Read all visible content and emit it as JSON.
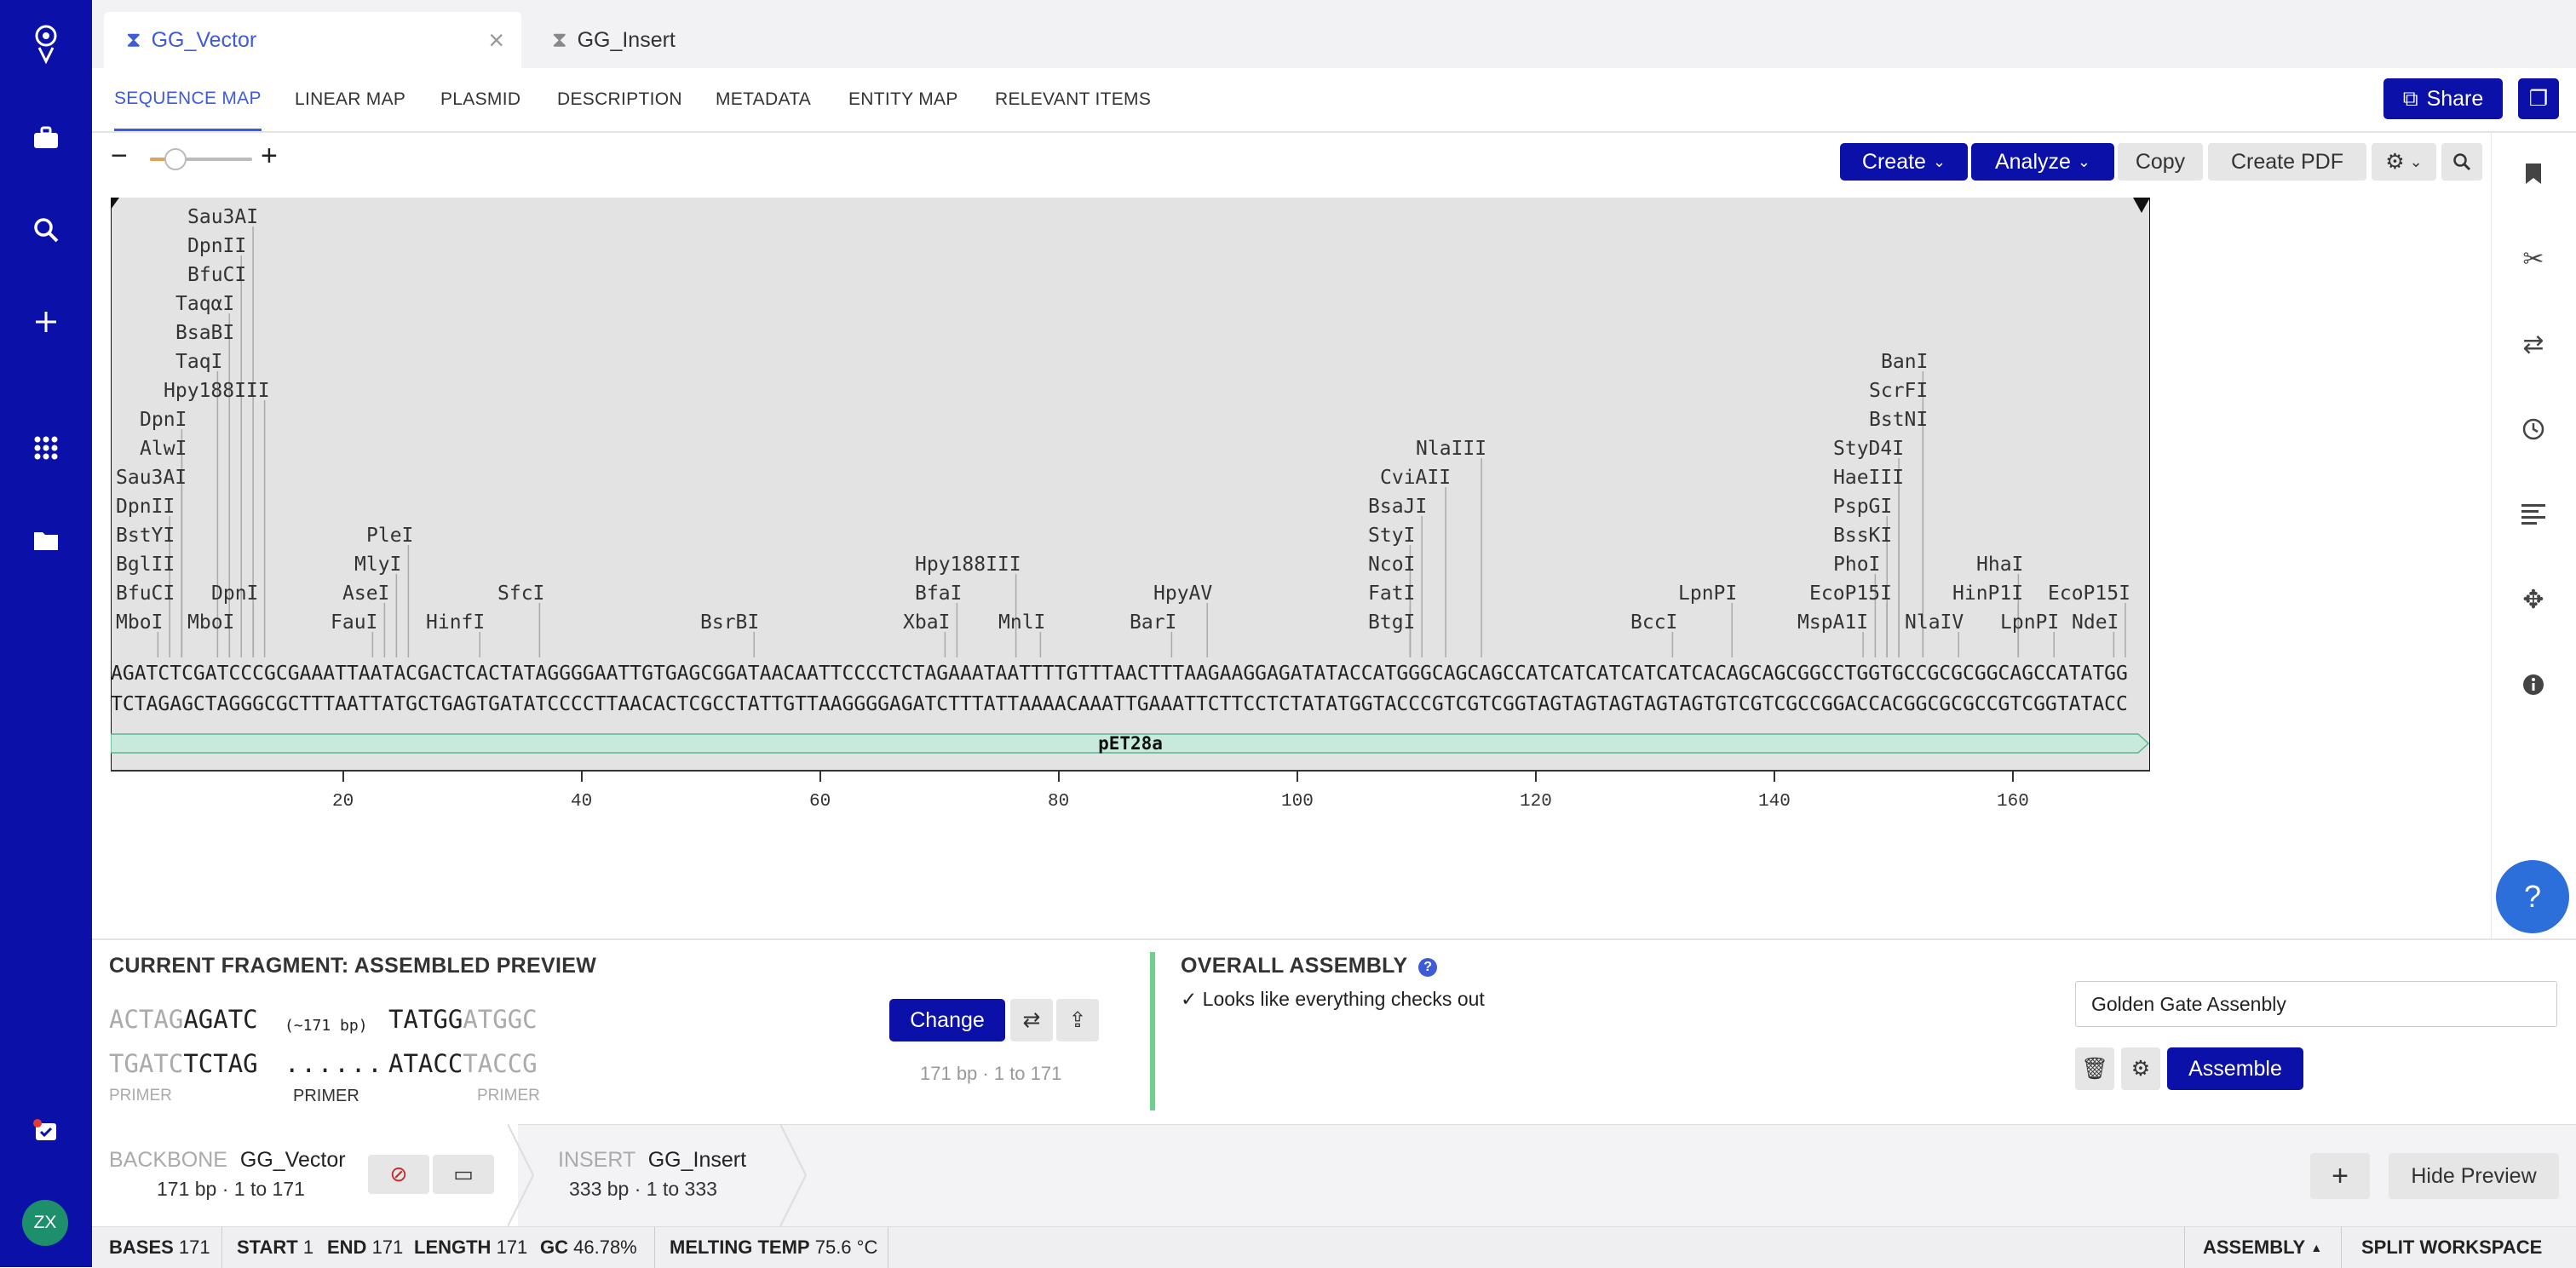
{
  "tabs": [
    {
      "label": "GG_Vector",
      "active": true
    },
    {
      "label": "GG_Insert",
      "active": false
    }
  ],
  "subnav": [
    "SEQUENCE MAP",
    "LINEAR MAP",
    "PLASMID",
    "DESCRIPTION",
    "METADATA",
    "ENTITY MAP",
    "RELEVANT ITEMS"
  ],
  "share_label": "Share",
  "toolbar": {
    "create": "Create",
    "analyze": "Analyze",
    "copy": "Copy",
    "create_pdf": "Create PDF",
    "zoom_level": 0.25
  },
  "map": {
    "enzymes": [
      "Sau3AI",
      "DpnII",
      "BfuCI",
      "TaqαI",
      "BsaBI",
      "TaqI",
      "Hpy188III",
      "DpnI",
      "AlwI",
      "Sau3AI",
      "DpnII",
      "BstYI",
      "BglII",
      "BfuCI",
      "MboI",
      "MboI",
      "DpnI",
      "PleI",
      "MlyI",
      "AseI",
      "FauI",
      "HinfI",
      "SfcI",
      "BsrBI",
      "Hpy188III",
      "BfaI",
      "XbaI",
      "MnlI",
      "HpyAV",
      "BarI",
      "NlaIII",
      "CviAII",
      "BsaJI",
      "StyI",
      "NcoI",
      "FatI",
      "BtgI",
      "LpnPI",
      "BccI",
      "BanI",
      "ScrFI",
      "BstNI",
      "StyD4I",
      "HaeIII",
      "PspGI",
      "BssKI",
      "PhoI",
      "EcoP15I",
      "MspA1I",
      "HhaI",
      "HinP1I",
      "NlaIV",
      "LpnPI",
      "EcoP15I",
      "NdeI"
    ],
    "seq_top": "AGATCTCGATCCCGCGAAATTAATACGACTCACTATAGGGGAATTGTGAGCGGATAACAATTCCCCTCTAGAAATAATTTTGTTTAACTTTAAGAAGGAGATATACCATGGGCAGCAGCCATCATCATCATCATCACAGCAGCGGCCTGGTGCCGCGCGGCAGCCATATGG",
    "seq_bottom": "TCTAGAGCTAGGGCGCTTTAATTATGCTGAGTGATATCCCCTTAACACTCGCCTATTGTTAAGGGGAGATCTTTATTAAAACAAATTGAAATTCTTCCTCTATATGGTACCCGTCGTCGGTAGTAGTAGTAGTAGTGTCGTCGCCGGACCACGGCGCGCCGTCGGTATACC",
    "feature": "pET28a",
    "ticks": [
      "20",
      "40",
      "60",
      "80",
      "100",
      "120",
      "140",
      "160"
    ]
  },
  "fragment": {
    "title": "CURRENT FRAGMENT: ASSEMBLED PREVIEW",
    "left_top_grey": "ACTAG",
    "left_top": "AGATC",
    "left_bot_grey": "TGATC",
    "left_bot": "TCTAG",
    "mid_top": "(~171 bp)",
    "mid_bot": "......",
    "right_top": "TATGG",
    "right_top_grey": "ATGGC",
    "right_bot": "ATACC",
    "right_bot_grey": "TACCG",
    "primer_left": "PRIMER",
    "primer_mid": "PRIMER",
    "primer_right": "PRIMER",
    "change": "Change",
    "range": "171 bp · 1 to 171"
  },
  "assembly": {
    "title": "OVERALL ASSEMBLY",
    "status": "Looks like everything checks out",
    "name_value": "Golden Gate Assenbly",
    "assemble": "Assemble"
  },
  "parts": {
    "backbone_label": "BACKBONE",
    "backbone_name": "GG_Vector",
    "backbone_info": "171 bp  ·  1 to 171",
    "insert_label": "INSERT",
    "insert_name": "GG_Insert",
    "insert_info": "333 bp  ·  1 to 333",
    "hide_preview": "Hide Preview"
  },
  "status": {
    "bases_label": "BASES",
    "bases": "171",
    "start_label": "START",
    "start": "1",
    "end_label": "END",
    "end": "171",
    "length_label": "LENGTH",
    "length": "171",
    "gc_label": "GC",
    "gc": "46.78%",
    "melt_label": "MELTING TEMP",
    "melt": "75.6 °C",
    "assembly": "ASSEMBLY",
    "split": "SPLIT WORKSPACE"
  },
  "user_initials": "ZX",
  "colors": {
    "nav": "#0b10a8",
    "accent": "#3e5bd9",
    "feature": "#c8eadc",
    "ok": "#6fd08e"
  }
}
